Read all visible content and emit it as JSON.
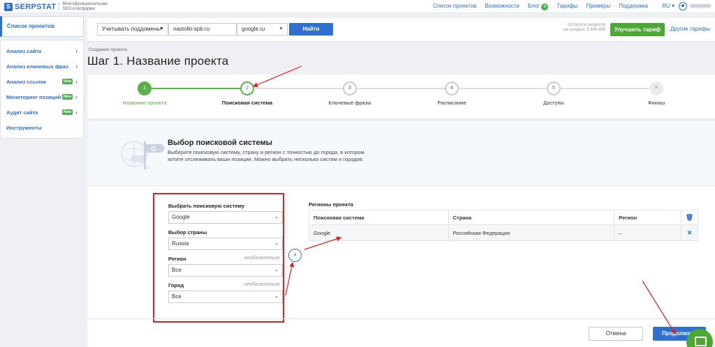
{
  "brand": {
    "logo_mark": "S",
    "name": "SERPSTAT",
    "tagline": "Многофункциональная SEO-платформа"
  },
  "topnav": {
    "items": [
      "Список проектов",
      "Возможности",
      "Блог",
      "Тарифы",
      "Примеры",
      "Поддержка"
    ],
    "blog_badge": "9",
    "lang": "RU ▾"
  },
  "sidebar": {
    "active": "Список проектов",
    "items": [
      {
        "label": "Анализ сайта",
        "new": ""
      },
      {
        "label": "Анализ ключевых фраз",
        "new": ""
      },
      {
        "label": "Анализ ссылок",
        "new": "New"
      },
      {
        "label": "Мониторинг позиций",
        "new": "New"
      },
      {
        "label": "Аудит сайта",
        "new": "New"
      },
      {
        "label": "Инструменты",
        "new": ""
      }
    ]
  },
  "searchbar": {
    "subdomains": "Учитывать поддомены",
    "domain": "nastolki-spb.ru",
    "engine": "google.ru",
    "find_button": "Найти",
    "limits_line1": "Осталось запросов",
    "limits_line2": "на сегодня: 9 999 994",
    "upgrade_button": "Улучшить тариф",
    "other_plans": "Другие тарифы"
  },
  "page": {
    "breadcrumb": "Создание проекта",
    "title": "Шаг 1. Название проекта"
  },
  "stepper": {
    "steps": [
      {
        "num": "1",
        "label": "Название проекта",
        "state": "done"
      },
      {
        "num": "2",
        "label": "Поисковая система",
        "state": "active"
      },
      {
        "num": "3",
        "label": "Ключевые фразы",
        "state": "todo"
      },
      {
        "num": "4",
        "label": "Расписание",
        "state": "todo"
      },
      {
        "num": "5",
        "label": "Доступы",
        "state": "todo"
      },
      {
        "num": "",
        "label": "Финиш",
        "state": "finish"
      }
    ]
  },
  "engine_section": {
    "title": "Выбор поисковой системы",
    "description": "Выберите поисковую систему, страну и регион с точностью до города, в котором хотите отслеживать ваши позиции. Можно выбрать несколько систем и городов."
  },
  "form": {
    "engine_label": "Выбрать поисковую систему",
    "engine_value": "Google",
    "country_label": "Выбор страны",
    "country_value": "Russia",
    "region_label": "Регион",
    "region_optional": "необязательно",
    "region_value": "Все",
    "city_label": "Город",
    "city_optional": "необязательно",
    "city_value": "Все"
  },
  "regions": {
    "title": "Регионы проекта",
    "columns": [
      "Поисковая система",
      "Страна",
      "Регион"
    ],
    "rows": [
      {
        "engine": "Google",
        "country": "Российская Федерация",
        "region": "–"
      }
    ]
  },
  "actions": {
    "cancel": "Отмена",
    "next": "Продолжить"
  },
  "colors": {
    "accent": "#2f6fd1",
    "success": "#5cb04d",
    "annotation": "#e02020"
  }
}
